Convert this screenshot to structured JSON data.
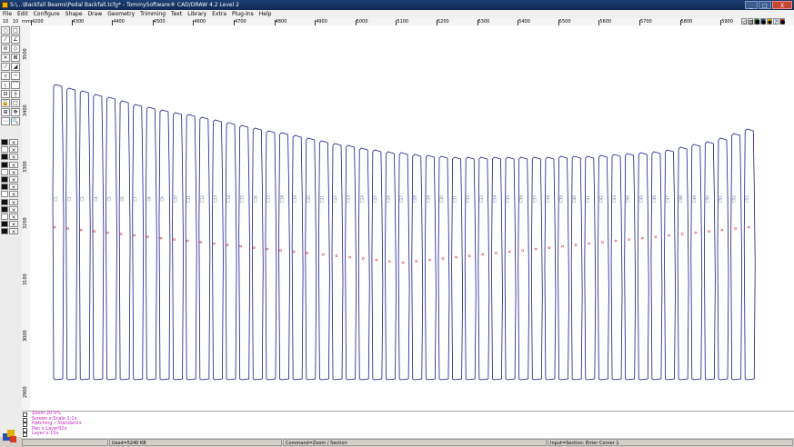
{
  "window": {
    "title": "S:\\...\\Backfall Beams\\Pedal Backfall.tcfg* - TommySoftware® CAD/DRAW 4.2 Level 2",
    "buttons": [
      "_",
      "□",
      "X"
    ]
  },
  "menu": [
    "File",
    "Edit",
    "Configure",
    "Shape",
    "Draw",
    "Geometry",
    "Trimming",
    "Text",
    "Library",
    "Extra",
    "Plug-Ins",
    "Help"
  ],
  "ruler": {
    "zoom_left": "10",
    "zoom_mid": "10",
    "unit": "mm",
    "h_ticks": [
      "4200",
      "4300",
      "4400",
      "4500",
      "4600",
      "4700",
      "4800",
      "4900",
      "5000",
      "5100",
      "5200",
      "5300",
      "5400",
      "5500",
      "5600",
      "5700",
      "5800",
      "5900"
    ],
    "v_ticks": [
      "3500",
      "3400",
      "3300",
      "3200",
      "3100",
      "3000",
      "2900"
    ]
  },
  "right_tools": [
    "◁",
    "▥",
    "■",
    "●",
    "◆",
    "?",
    "●"
  ],
  "left_toolbar": {
    "tools": [
      "○",
      "□",
      "⁄",
      "∠",
      "⊘",
      "◇",
      "✕",
      "⊠",
      "⁄",
      "◢",
      "┬",
      "─",
      "╮",
      "⌒",
      "⊟",
      "┼",
      "🔒",
      "□",
      "⊞",
      "✥",
      "⋯",
      "🔍"
    ],
    "layer_rows": 13
  },
  "drawing": {
    "beam_count": 53,
    "top_left_heights": [
      93,
      97,
      100,
      104,
      107,
      111,
      115,
      118,
      121,
      124,
      126,
      129,
      132,
      135,
      138,
      141,
      144,
      146,
      149,
      152,
      155,
      158,
      160,
      163,
      165,
      167,
      168,
      170,
      171,
      172,
      173,
      173,
      173,
      173,
      173,
      173,
      173,
      173,
      172,
      172,
      172,
      171,
      170,
      169,
      168,
      167,
      165,
      162,
      159,
      156,
      152,
      147,
      142
    ],
    "line_color": "#1b1b8c",
    "hole_color": "#d83a3a",
    "label_color": "#6e6e9a",
    "labels": [
      "C1",
      "C2",
      "C3",
      "C4",
      "C5",
      "C6",
      "C7",
      "C8",
      "C9",
      "C10",
      "C11",
      "C12",
      "C13",
      "C14",
      "C15",
      "C16",
      "C17",
      "C18",
      "C19",
      "C20",
      "C21",
      "C22",
      "C23",
      "C24",
      "C25",
      "C26",
      "C27",
      "C28",
      "C29",
      "C30",
      "C31",
      "C32",
      "C33",
      "C34",
      "C35",
      "C36",
      "C37",
      "C38",
      "C39",
      "C40",
      "C41",
      "C42",
      "C43",
      "C44",
      "C45",
      "C46",
      "C47",
      "C48",
      "C49",
      "C50",
      "C51",
      "C52",
      "C53"
    ]
  },
  "info_lines": [
    "Zoom 20.5%",
    "Screen x:Scale 1:1x",
    "Hatching ✓Standard+",
    "Pen x:Layer02x",
    "Layer x:15x"
  ],
  "status": {
    "used": "Used=5240 KB",
    "command": "Command=Zoom / Section",
    "input": "Input=Section: Enter Corner 1"
  }
}
